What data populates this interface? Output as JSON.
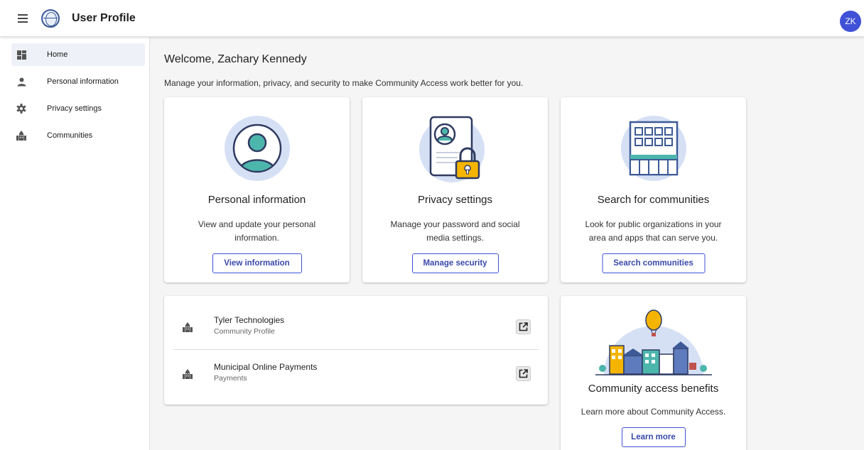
{
  "header": {
    "title": "User Profile",
    "avatar_initials": "ZK",
    "accent": "#3f51d6"
  },
  "sidebar": {
    "items": [
      {
        "label": "Home",
        "icon": "dashboard-icon",
        "active": true
      },
      {
        "label": "Personal information",
        "icon": "person-icon",
        "active": false
      },
      {
        "label": "Privacy settings",
        "icon": "gear-icon",
        "active": false
      },
      {
        "label": "Communities",
        "icon": "city-buildings-icon",
        "active": false
      }
    ]
  },
  "main": {
    "welcome": "Welcome, Zachary Kennedy",
    "subtitle": "Manage your information, privacy, and security to make Community Access work better for you.",
    "cards": [
      {
        "title": "Personal information",
        "desc_line1": "View and update your personal",
        "desc_line2": "information.",
        "button": "View information",
        "illustration": "person-avatar-illustration"
      },
      {
        "title": "Privacy settings",
        "desc_line1": "Manage your password and social",
        "desc_line2": "media settings.",
        "button": "Manage security",
        "illustration": "id-card-lock-illustration"
      },
      {
        "title": "Search for communities",
        "desc_line1": "Look for public organizations in your",
        "desc_line2": "area and apps that can serve you.",
        "button": "Search communities",
        "illustration": "building-illustration"
      }
    ],
    "communities": [
      {
        "name": "Tyler Technologies",
        "type": "Community Profile",
        "icon": "city-buildings-icon",
        "action_icon": "open-external-icon"
      },
      {
        "name": "Municipal Online Payments",
        "type": "Payments",
        "icon": "city-buildings-icon",
        "action_icon": "open-external-icon"
      }
    ],
    "benefits": {
      "title": "Community access benefits",
      "desc": "Learn more about Community Access.",
      "button": "Learn more",
      "illustration": "town-balloon-illustration"
    }
  }
}
